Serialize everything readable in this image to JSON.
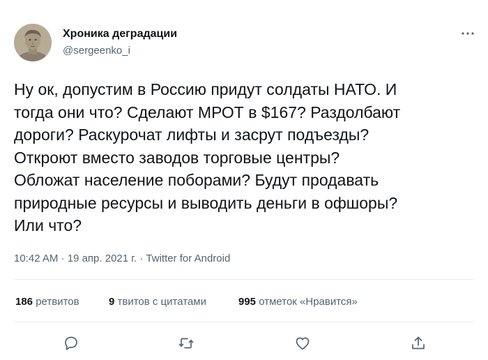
{
  "author": {
    "name": "Хроника деградации",
    "handle": "@sergeenko_i",
    "avatar_icon": "avatar-bust-icon"
  },
  "tweet": {
    "lines": [
      "Ну ок, допустим в Россию придут солдаты НАТО. И",
      "тогда они что? Сделают МРОТ в $167? Раздолбают",
      "дороги? Раскурочат лифты и засрут подъезды?",
      "Откроют вместо заводов торговые центры?",
      "Обложат население поборами? Будут продавать",
      "природные ресурсы и выводить деньги в офшоры?",
      "Или что?"
    ]
  },
  "meta": {
    "time": "10:42 AM",
    "sep1": " · ",
    "date": "19 апр. 2021 г.",
    "sep2": " · ",
    "source": "Twitter for Android"
  },
  "stats": {
    "retweets": {
      "count": "186",
      "label": "ретвитов"
    },
    "quotes": {
      "count": "9",
      "label": "твитов с цитатами"
    },
    "likes": {
      "count": "995",
      "label": "отметок «Нравится»"
    }
  },
  "actions": [
    "reply-icon",
    "retweet-icon",
    "like-icon",
    "share-icon"
  ],
  "colors": {
    "text": "#0f1419",
    "secondary": "#536471",
    "divider": "#e6ecf0",
    "action_icon": "#536471"
  }
}
